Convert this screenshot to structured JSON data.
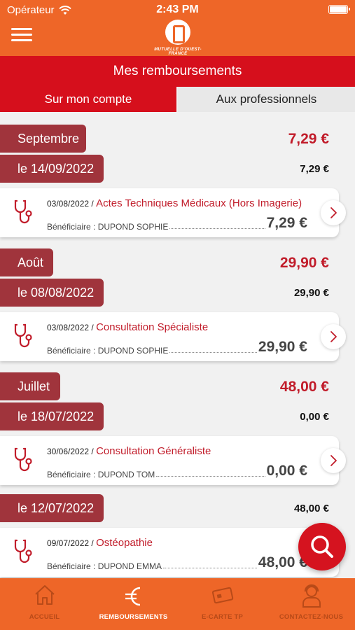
{
  "status_bar": {
    "carrier": "Opérateur",
    "time": "2:43 PM"
  },
  "header": {
    "logo_text": "MUTUELLE D'OUEST-FRANCE",
    "title": "Mes remboursements"
  },
  "tabs": [
    {
      "label": "Sur mon compte",
      "active": true
    },
    {
      "label": "Aux professionnels",
      "active": false
    }
  ],
  "months": [
    {
      "label": "Septembre",
      "total": "7,29 €"
    },
    {
      "label": "Août",
      "total": "29,90 €"
    },
    {
      "label": "Juillet",
      "total": "48,00 €"
    }
  ],
  "payments": [
    {
      "date": "le 14/09/2022",
      "total": "7,29 €",
      "care_date": "03/08/2022",
      "act": "Actes Techniques Médicaux (Hors Imagerie)",
      "beneficiary": "Bénéficiaire : DUPOND SOPHIE",
      "amount": "7,29 €"
    },
    {
      "date": "le 08/08/2022",
      "total": "29,90 €",
      "care_date": "03/08/2022",
      "act": "Consultation Spécialiste",
      "beneficiary": "Bénéficiaire : DUPOND SOPHIE",
      "amount": "29,90 €"
    },
    {
      "date": "le 18/07/2022",
      "total": "0,00 €",
      "care_date": "30/06/2022",
      "act": "Consultation Généraliste",
      "beneficiary": "Bénéficiaire : DUPOND TOM",
      "amount": "0,00 €"
    },
    {
      "date": "le 12/07/2022",
      "total": "48,00 €",
      "care_date": "09/07/2022",
      "act": "Ostéopathie",
      "beneficiary": "Bénéficiaire : DUPOND EMMA",
      "amount": "48,00 €"
    }
  ],
  "separator": " / ",
  "bottom_nav": [
    {
      "label": "ACCUEIL",
      "icon": "home-icon",
      "active": false
    },
    {
      "label": "REMBOURSEMENTS",
      "icon": "euro-icon",
      "active": true
    },
    {
      "label": "E-CARTE TP",
      "icon": "card-icon",
      "active": false
    },
    {
      "label": "CONTACTEZ-NOUS",
      "icon": "contact-icon",
      "active": false
    }
  ],
  "colors": {
    "brand_orange": "#ee6628",
    "brand_red": "#d60f1c",
    "tag_red": "#a0343c",
    "amount_red": "#c11c2a"
  }
}
